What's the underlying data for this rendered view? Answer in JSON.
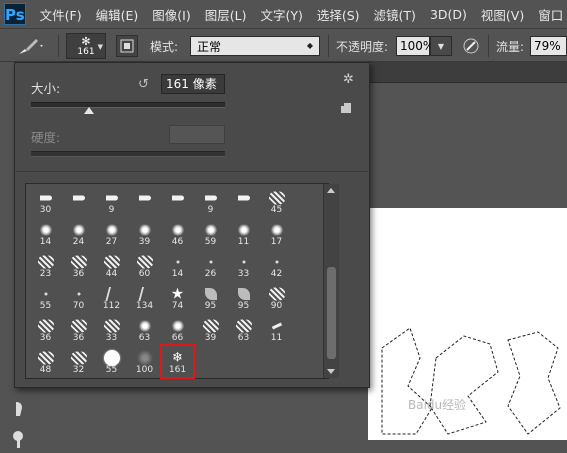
{
  "app": {
    "logo": "Ps"
  },
  "menubar": {
    "items": [
      "文件(F)",
      "编辑(E)",
      "图像(I)",
      "图层(L)",
      "文字(Y)",
      "选择(S)",
      "滤镜(T)",
      "3D(D)",
      "视图(V)",
      "窗口"
    ]
  },
  "options": {
    "brush_size": "161",
    "mode_label": "模式:",
    "mode_value": "正常",
    "opacity_label": "不透明度:",
    "opacity_value": "100%",
    "flow_label": "流量:",
    "flow_value": "79%"
  },
  "panel": {
    "size_label": "大小:",
    "size_value": "161 像素",
    "size_slider_value": 0.3,
    "hardness_label": "硬度:"
  },
  "brushes": [
    {
      "label": "30",
      "shape": "tip"
    },
    {
      "label": "",
      "shape": "tip"
    },
    {
      "label": "9",
      "shape": "tip"
    },
    {
      "label": "",
      "shape": "tip"
    },
    {
      "label": "",
      "shape": "tip"
    },
    {
      "label": "9",
      "shape": "tip"
    },
    {
      "label": "",
      "shape": "tip"
    },
    {
      "label": "45",
      "shape": "fuzz"
    },
    {
      "label": "14",
      "shape": "blob"
    },
    {
      "label": "24",
      "shape": "blob"
    },
    {
      "label": "27",
      "shape": "blob"
    },
    {
      "label": "39",
      "shape": "blob"
    },
    {
      "label": "46",
      "shape": "blob"
    },
    {
      "label": "59",
      "shape": "blob"
    },
    {
      "label": "11",
      "shape": "blob"
    },
    {
      "label": "17",
      "shape": "blob"
    },
    {
      "label": "23",
      "shape": "fuzz"
    },
    {
      "label": "36",
      "shape": "fuzz"
    },
    {
      "label": "44",
      "shape": "fuzz"
    },
    {
      "label": "60",
      "shape": "fuzz"
    },
    {
      "label": "14",
      "shape": "dot"
    },
    {
      "label": "26",
      "shape": "dot"
    },
    {
      "label": "33",
      "shape": "dot"
    },
    {
      "label": "42",
      "shape": "dot"
    },
    {
      "label": "55",
      "shape": "dot"
    },
    {
      "label": "70",
      "shape": "dot"
    },
    {
      "label": "112",
      "shape": "grass"
    },
    {
      "label": "134",
      "shape": "grass"
    },
    {
      "label": "74",
      "shape": "star"
    },
    {
      "label": "95",
      "shape": "leaf"
    },
    {
      "label": "95",
      "shape": "leaf"
    },
    {
      "label": "90",
      "shape": "fuzz"
    },
    {
      "label": "36",
      "shape": "fuzz"
    },
    {
      "label": "36",
      "shape": "fuzz"
    },
    {
      "label": "33",
      "shape": "fuzz"
    },
    {
      "label": "63",
      "shape": "blob"
    },
    {
      "label": "66",
      "shape": "blob"
    },
    {
      "label": "39",
      "shape": "fuzz"
    },
    {
      "label": "63",
      "shape": "fuzz"
    },
    {
      "label": "11",
      "shape": "stroke"
    },
    {
      "label": "48",
      "shape": "fuzz"
    },
    {
      "label": "32",
      "shape": "fuzz"
    },
    {
      "label": "55",
      "shape": "circle"
    },
    {
      "label": "100",
      "shape": "soft"
    },
    {
      "label": "161",
      "shape": "flake",
      "selected": true
    }
  ],
  "canvas": {
    "watermark": "Baidu经验"
  },
  "colors": {
    "ui_bg": "#535353",
    "panel_bg": "#4a4a4a",
    "selection": "#dc1818",
    "canvas": "#ffffff"
  }
}
